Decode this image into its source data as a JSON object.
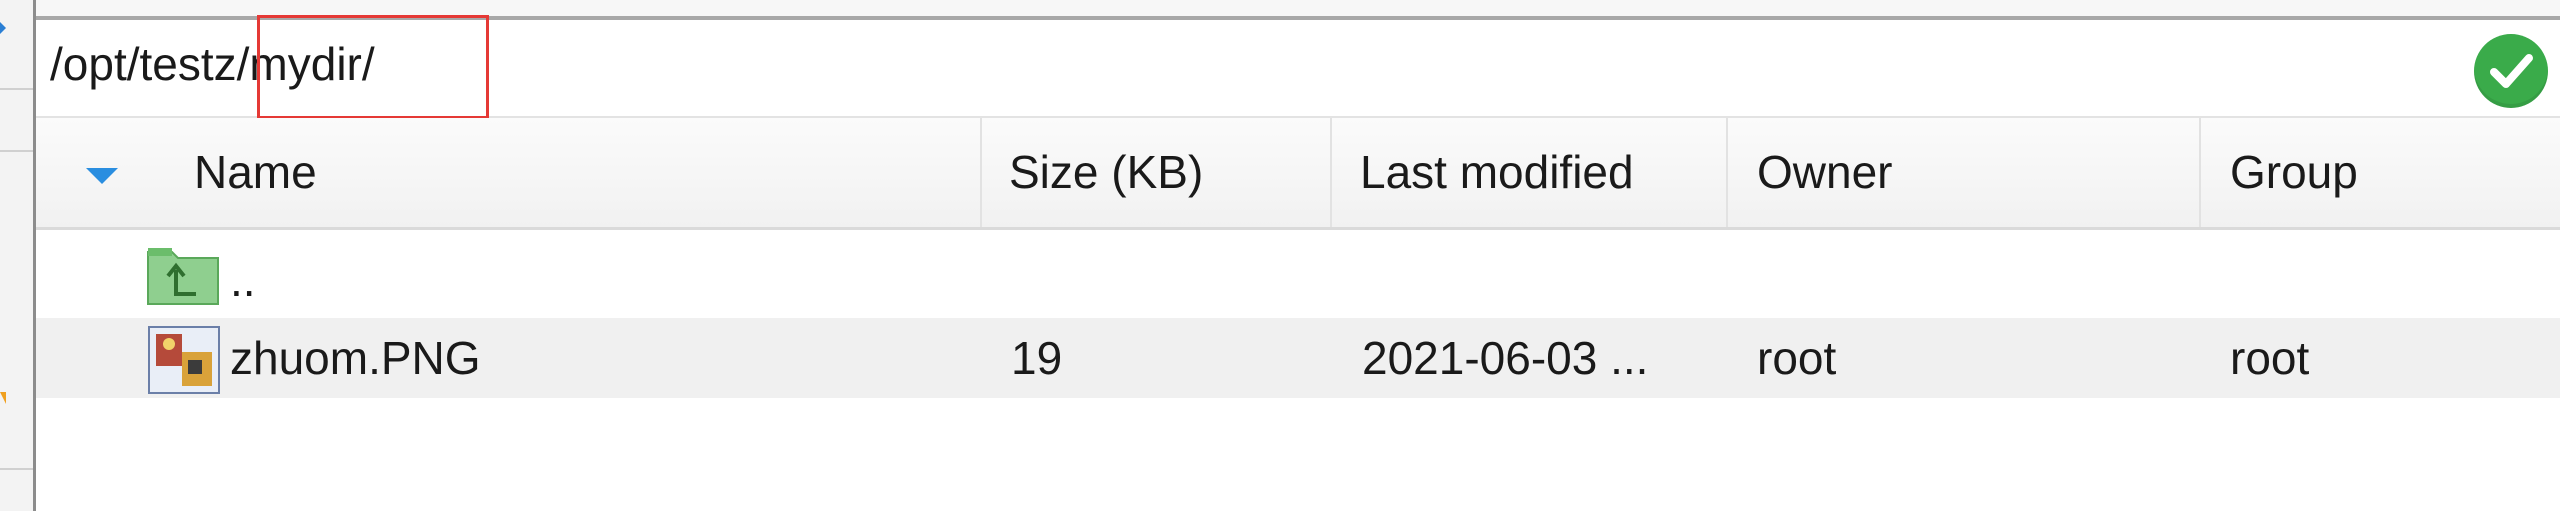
{
  "path_bar": {
    "value": "/opt/testz/mydir/",
    "status_icon": "check-circle-icon",
    "status_color": "#3aab4a",
    "highlight_color": "#e53935"
  },
  "columns": {
    "name": "Name",
    "size": "Size (KB)",
    "modified": "Last modified",
    "owner": "Owner",
    "group": "Group",
    "sort_indicator": "sort-descending-icon"
  },
  "rows": [
    {
      "icon": "folder-up-icon",
      "name": "..",
      "size": "",
      "modified": "",
      "owner": "",
      "group": ""
    },
    {
      "icon": "image-file-icon",
      "name": "zhuom.PNG",
      "size": "19",
      "modified": "2021-06-03 ...",
      "owner": "root",
      "group": "root"
    }
  ]
}
